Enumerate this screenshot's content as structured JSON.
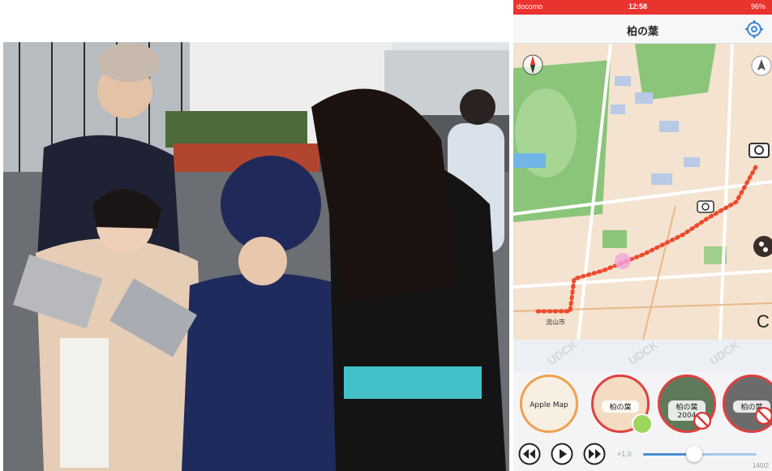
{
  "status_bar": {
    "carrier": "docomo",
    "time": "12:58",
    "battery": "96%"
  },
  "app": {
    "title": "柏の葉"
  },
  "map": {
    "labels": [
      "流山市"
    ],
    "watermark": "UDCK"
  },
  "layers": [
    {
      "label": "Apple Map",
      "selected": false
    },
    {
      "label": "柏の葉",
      "selected": true
    },
    {
      "label": "柏の葉2004",
      "selected": false
    },
    {
      "label": "柏の葉",
      "selected": false
    }
  ],
  "playback": {
    "speed": "×1.0",
    "progress": 0.45,
    "counter": "140/2"
  },
  "side_label": "C",
  "colors": {
    "status_bar": "#e8332f",
    "route": "#ee4a2e",
    "accent": "#4a90d9",
    "park": "#8bc57a"
  },
  "icons": [
    "gear-icon",
    "compass-icon",
    "locate-icon",
    "camera-icon",
    "rewind-icon",
    "play-icon",
    "fast-forward-icon",
    "no-entry-icon",
    "walk-icon"
  ]
}
